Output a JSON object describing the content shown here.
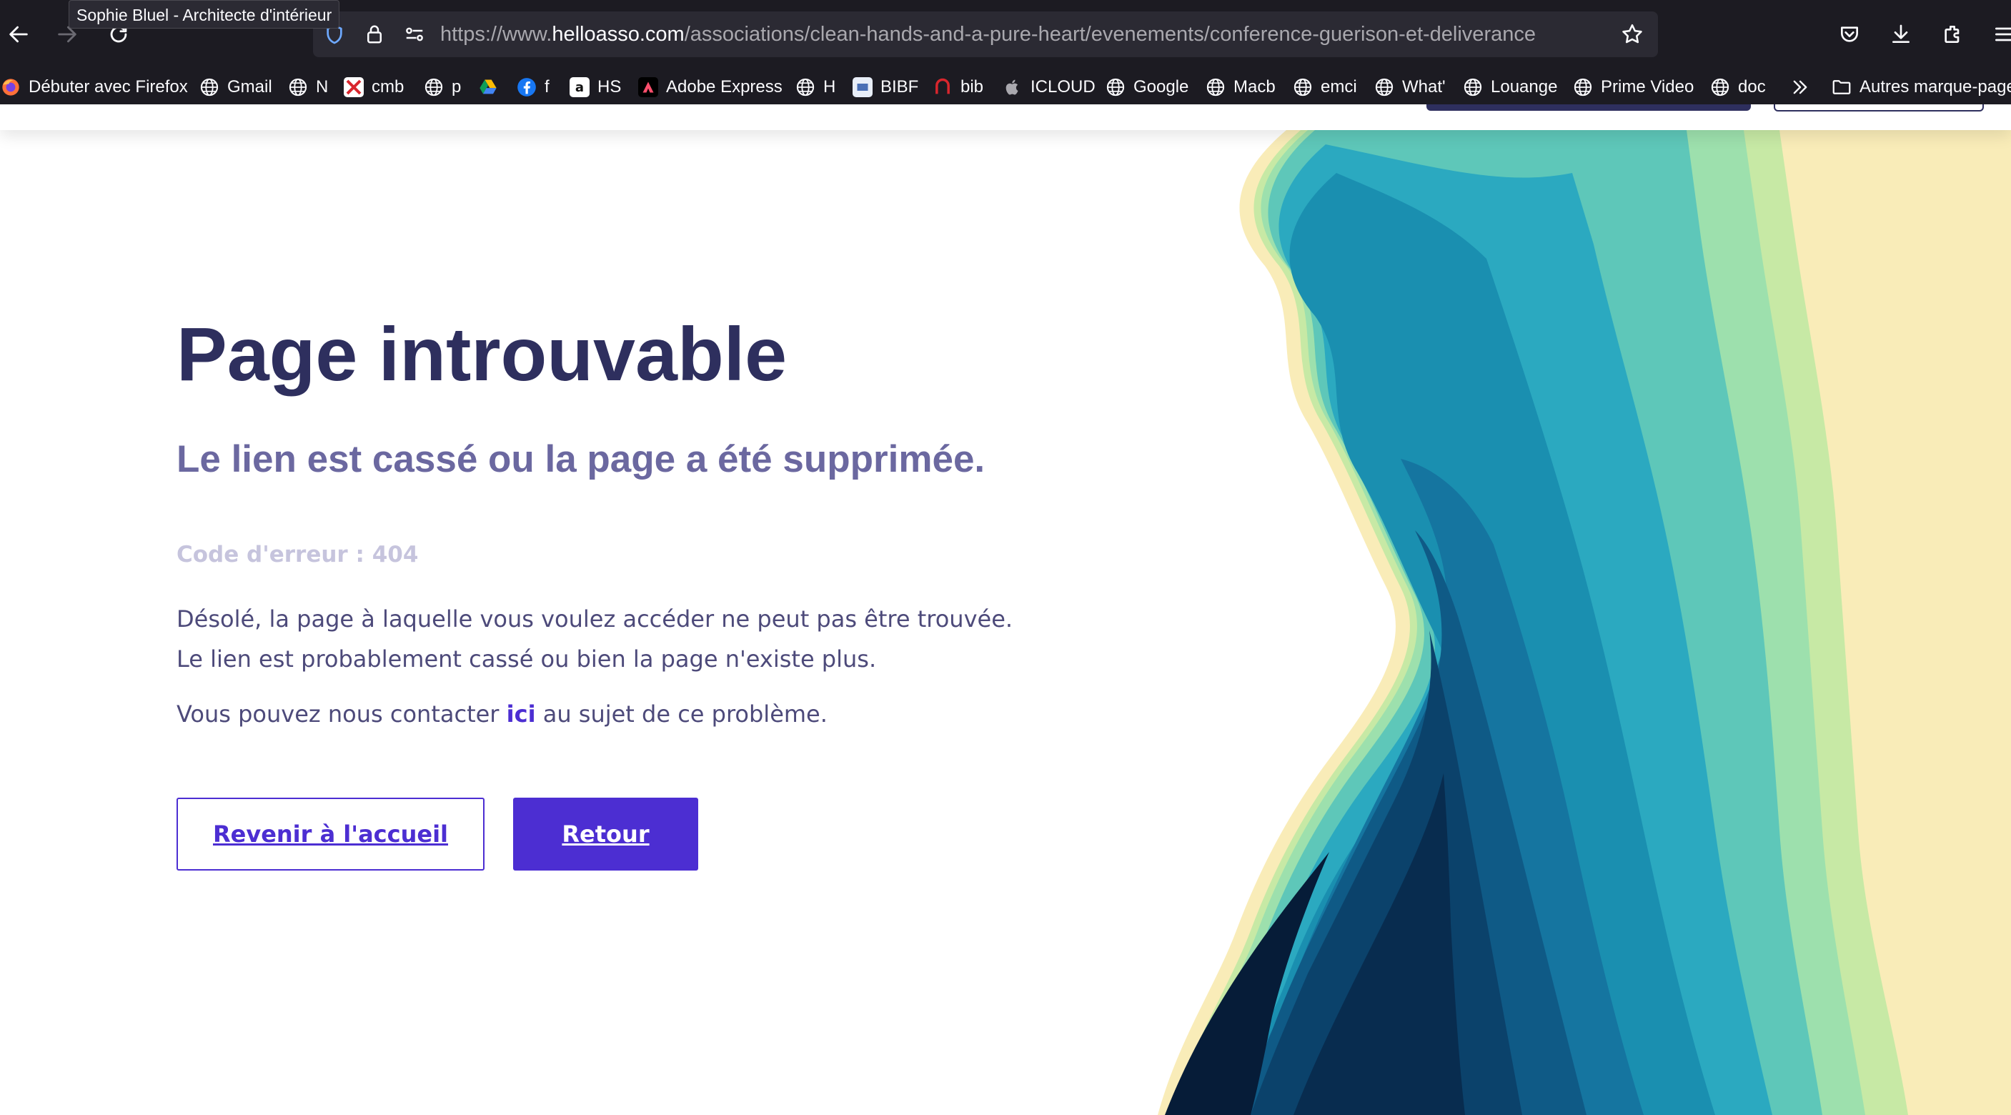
{
  "browser": {
    "tooltip": "Sophie Bluel - Architecte d'intérieur",
    "url": {
      "protocol": "https://www.",
      "host": "helloasso.com",
      "path": "/associations/clean-hands-and-a-pure-heart/evenements/conference-guerison-et-deliverance"
    },
    "icons": {
      "back": "back-arrow-icon",
      "forward": "forward-arrow-icon",
      "reload": "reload-icon",
      "shield": "tracking-protection-shield-icon",
      "lock": "lock-icon",
      "permissions": "permissions-icon",
      "bookmark_star": "star-icon",
      "pocket": "pocket-icon",
      "downloads": "download-icon",
      "extensions": "extensions-icon",
      "overflow": "chevron-double-right-icon",
      "folder": "folder-icon"
    },
    "bookmarks": [
      {
        "label": "Débuter avec Firefox",
        "icon": "firefox-icon"
      },
      {
        "label": "Gmail",
        "icon": "globe-icon"
      },
      {
        "label": "N",
        "icon": "globe-icon"
      },
      {
        "label": "cmb",
        "icon": "cmb-icon"
      },
      {
        "label": "p",
        "icon": "globe-icon"
      },
      {
        "label": "",
        "icon": "google-drive-icon"
      },
      {
        "label": "f",
        "icon": "facebook-icon"
      },
      {
        "label": "HS",
        "icon": "amazon-icon"
      },
      {
        "label": "Adobe Express",
        "icon": "adobe-express-icon"
      },
      {
        "label": "H",
        "icon": "globe-icon"
      },
      {
        "label": "BIBF",
        "icon": "bibf-icon"
      },
      {
        "label": "bib",
        "icon": "bib-icon"
      },
      {
        "label": "ICLOUD",
        "icon": "apple-icon"
      },
      {
        "label": "Google",
        "icon": "globe-icon"
      },
      {
        "label": "Macb",
        "icon": "globe-icon"
      },
      {
        "label": "emci",
        "icon": "globe-icon"
      },
      {
        "label": "What'",
        "icon": "globe-icon"
      },
      {
        "label": "Louange",
        "icon": "globe-icon"
      },
      {
        "label": "Prime Video",
        "icon": "globe-icon"
      },
      {
        "label": "doc",
        "icon": "globe-icon"
      }
    ],
    "other_bookmarks": "Autres marque-pages"
  },
  "page": {
    "title": "Page introuvable",
    "subtitle": "Le lien est cassé ou la page a été supprimée.",
    "error_code": "Code d'erreur : 404",
    "description": "Désolé, la page à laquelle vous voulez accéder ne peut pas être trouvée. Le lien est probablement cassé ou bien la page n'existe plus.",
    "contact_before": "Vous pouvez nous contacter ",
    "contact_link": "ici",
    "contact_after": " au sujet de ce problème.",
    "button_home": "Revenir à l'accueil",
    "button_back": "Retour"
  },
  "colors": {
    "title": "#2e2f5e",
    "subtitle": "#6b68a0",
    "accent": "#4c2ed2",
    "chrome_bg": "#1c1b22",
    "urlbar_bg": "#2b2a33"
  }
}
